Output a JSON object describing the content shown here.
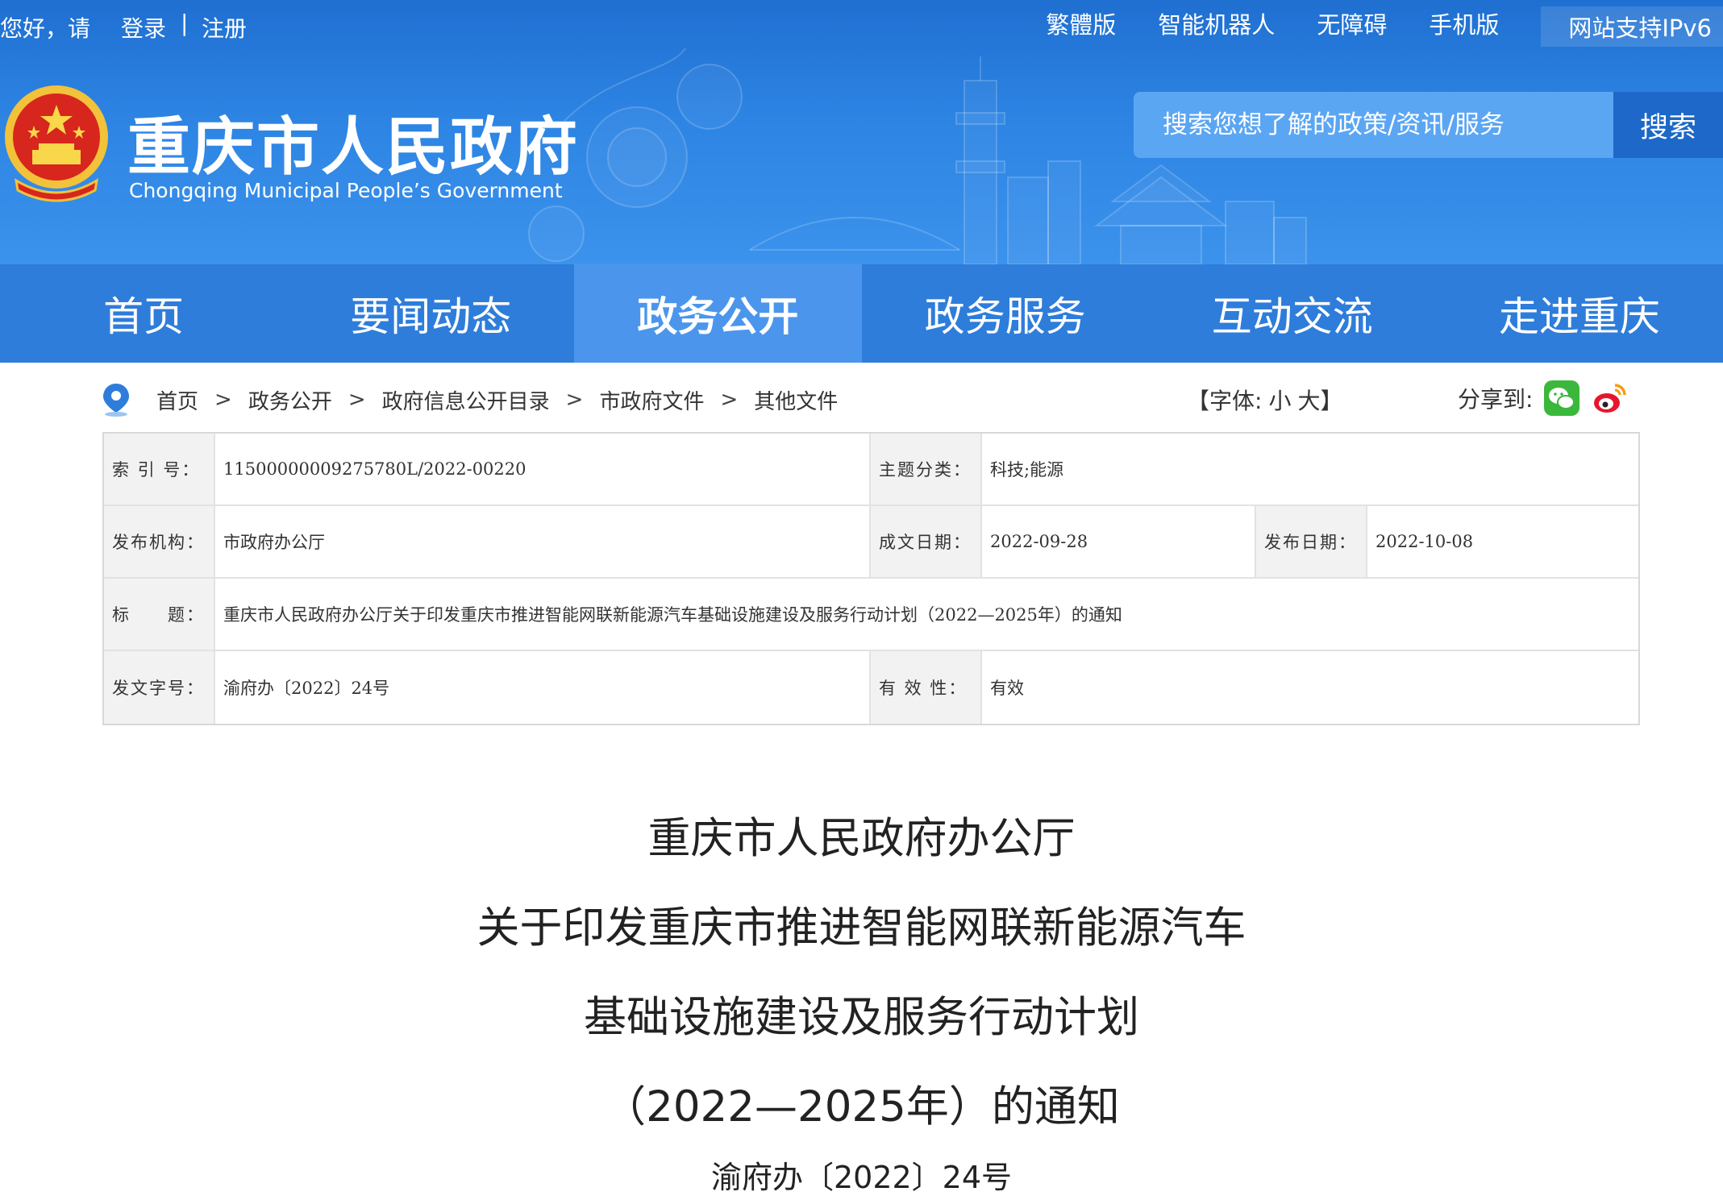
{
  "topbar": {
    "greeting": "您好，请",
    "login": "登录",
    "separator": "|",
    "register": "注册",
    "links": [
      "繁體版",
      "智能机器人",
      "无障碍",
      "手机版"
    ],
    "ipv6": "网站支持IPv6"
  },
  "site": {
    "title": "重庆市人民政府",
    "subtitle": "Chongqing Municipal People’s Government",
    "emblem_icon": "national-emblem"
  },
  "search": {
    "placeholder": "搜索您想了解的政策/资讯/服务",
    "button": "搜索"
  },
  "nav": {
    "items": [
      {
        "label": "首页"
      },
      {
        "label": "要闻动态"
      },
      {
        "label": "政务公开",
        "active": true
      },
      {
        "label": "政务服务"
      },
      {
        "label": "互动交流"
      },
      {
        "label": "走进重庆"
      }
    ]
  },
  "breadcrumb": {
    "icon": "location-pin-icon",
    "items": [
      "首页",
      "政务公开",
      "政府信息公开目录",
      "市政府文件",
      "其他文件"
    ],
    "arrow": ">"
  },
  "font_size": {
    "open": "【字体:",
    "small": "小",
    "large": "大】"
  },
  "share": {
    "label": "分享到:",
    "targets": [
      "wechat-icon",
      "weibo-icon"
    ]
  },
  "meta": {
    "index_label": "索 引 号：",
    "index_value": "11500000009275780L/2022-00220",
    "topic_label": "主题分类：",
    "topic_value": "科技;能源",
    "issuer_label": "发布机构：",
    "issuer_value": "市政府办公厅",
    "written_label": "成文日期：",
    "written_value": "2022-09-28",
    "published_label": "发布日期：",
    "published_value": "2022-10-08",
    "title_label": "标　　题：",
    "title_value": "重庆市人民政府办公厅关于印发重庆市推进智能网联新能源汽车基础设施建设及服务行动计划（2022—2025年）的通知",
    "docno_label": "发文字号：",
    "docno_value": "渝府办〔2022〕24号",
    "validity_label": "有 效 性：",
    "validity_value": "有效"
  },
  "document": {
    "title_lines": [
      "重庆市人民政府办公厅",
      "关于印发重庆市推进智能网联新能源汽车",
      "基础设施建设及服务行动计划",
      "（2022—2025年）的通知"
    ],
    "number": "渝府办〔2022〕24号"
  },
  "colors": {
    "header_blue": "#2e7ddb",
    "nav_active": "#4b96ec",
    "search_bg": "#5ba6f3",
    "search_button": "#1d68c8"
  }
}
